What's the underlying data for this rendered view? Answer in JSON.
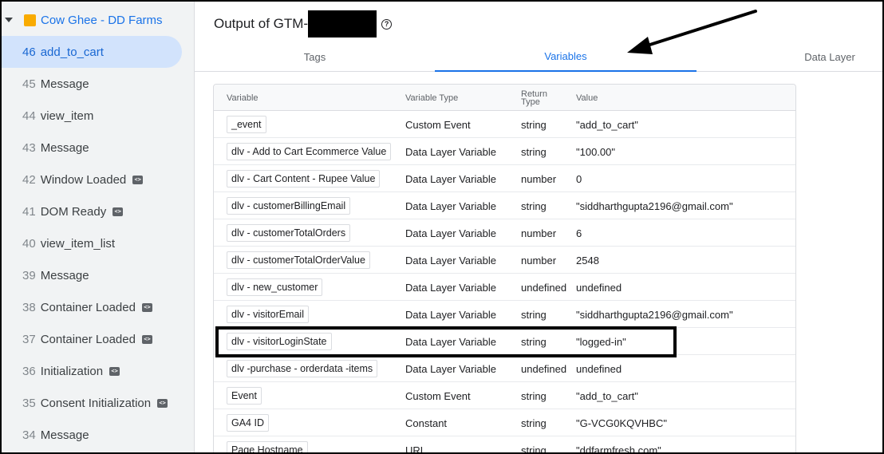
{
  "sidebar": {
    "container": {
      "name": "Cow Ghee - DD Farms"
    },
    "events": [
      {
        "num": "46",
        "label": "add_to_cart",
        "selected": true,
        "badge": false
      },
      {
        "num": "45",
        "label": "Message",
        "selected": false,
        "badge": false
      },
      {
        "num": "44",
        "label": "view_item",
        "selected": false,
        "badge": false
      },
      {
        "num": "43",
        "label": "Message",
        "selected": false,
        "badge": false
      },
      {
        "num": "42",
        "label": "Window Loaded",
        "selected": false,
        "badge": true
      },
      {
        "num": "41",
        "label": "DOM Ready",
        "selected": false,
        "badge": true
      },
      {
        "num": "40",
        "label": "view_item_list",
        "selected": false,
        "badge": false
      },
      {
        "num": "39",
        "label": "Message",
        "selected": false,
        "badge": false
      },
      {
        "num": "38",
        "label": "Container Loaded",
        "selected": false,
        "badge": true
      },
      {
        "num": "37",
        "label": "Container Loaded",
        "selected": false,
        "badge": true
      },
      {
        "num": "36",
        "label": "Initialization",
        "selected": false,
        "badge": true
      },
      {
        "num": "35",
        "label": "Consent Initialization",
        "selected": false,
        "badge": true
      },
      {
        "num": "34",
        "label": "Message",
        "selected": false,
        "badge": false
      }
    ],
    "badge_glyph": "<>"
  },
  "header": {
    "title_prefix": "Output of GTM-",
    "help_glyph": "?"
  },
  "tabs": [
    {
      "label": "Tags",
      "active": false
    },
    {
      "label": "Variables",
      "active": true
    },
    {
      "label": "Data Layer",
      "active": false
    }
  ],
  "table": {
    "headers": {
      "variable": "Variable",
      "variable_type": "Variable Type",
      "return_type_line1": "Return",
      "return_type_line2": "Type",
      "value": "Value"
    },
    "rows": [
      {
        "variable": "_event",
        "type": "Custom Event",
        "return": "string",
        "value": "\"add_to_cart\""
      },
      {
        "variable": "dlv - Add to Cart Ecommerce Value",
        "type": "Data Layer Variable",
        "return": "string",
        "value": "\"100.00\""
      },
      {
        "variable": "dlv - Cart Content - Rupee Value",
        "type": "Data Layer Variable",
        "return": "number",
        "value": "0"
      },
      {
        "variable": "dlv - customerBillingEmail",
        "type": "Data Layer Variable",
        "return": "string",
        "value": "\"siddharthgupta2196@gmail.com\""
      },
      {
        "variable": "dlv - customerTotalOrders",
        "type": "Data Layer Variable",
        "return": "number",
        "value": "6"
      },
      {
        "variable": "dlv - customerTotalOrderValue",
        "type": "Data Layer Variable",
        "return": "number",
        "value": "2548"
      },
      {
        "variable": "dlv - new_customer",
        "type": "Data Layer Variable",
        "return": "undefined",
        "value": "undefined"
      },
      {
        "variable": "dlv - visitorEmail",
        "type": "Data Layer Variable",
        "return": "string",
        "value": "\"siddharthgupta2196@gmail.com\""
      },
      {
        "variable": "dlv - visitorLoginState",
        "type": "Data Layer Variable",
        "return": "string",
        "value": "\"logged-in\""
      },
      {
        "variable": "dlv -purchase - orderdata -items",
        "type": "Data Layer Variable",
        "return": "undefined",
        "value": "undefined"
      },
      {
        "variable": "Event",
        "type": "Custom Event",
        "return": "string",
        "value": "\"add_to_cart\""
      },
      {
        "variable": "GA4 ID",
        "type": "Constant",
        "return": "string",
        "value": "\"G-VCG0KQVHBC\""
      },
      {
        "variable": "Page Hostname",
        "type": "URL",
        "return": "string",
        "value": "\"ddfarmfresh.com\""
      }
    ]
  },
  "colors": {
    "accent": "#1a73e8",
    "selected_bg": "#d2e3fc",
    "container_icon": "#f9ab00",
    "annotation": "#000000"
  }
}
